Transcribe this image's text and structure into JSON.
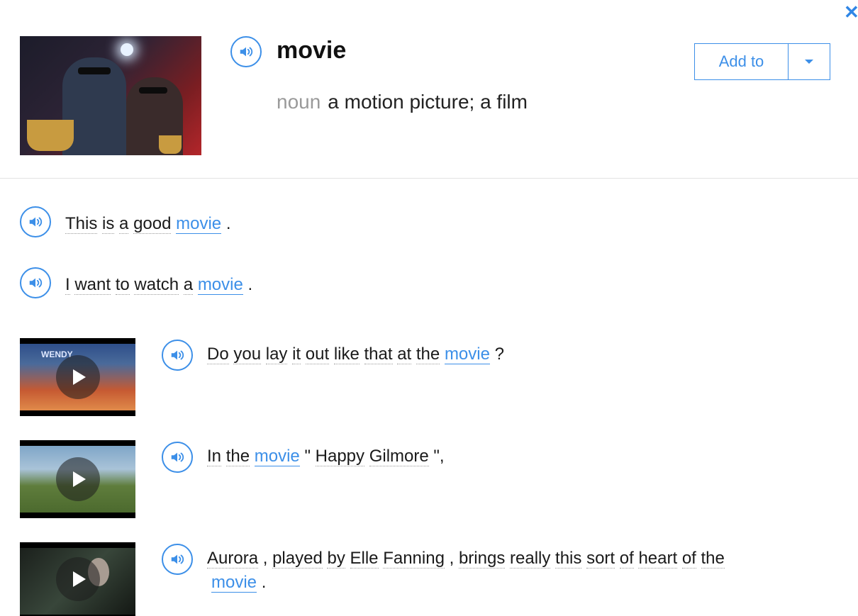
{
  "header": {
    "close_icon": "close-icon",
    "word": "movie",
    "part_of_speech": "noun",
    "definition": "a motion picture; a film",
    "add_to_label": "Add to",
    "add_to_caret_icon": "caret-down-icon"
  },
  "colors": {
    "accent": "#3c8fe8",
    "muted": "#9a9a9a",
    "text": "#1a1a1a"
  },
  "examples": [
    {
      "words": [
        "This",
        "is",
        "a",
        "good"
      ],
      "keyword": "movie",
      "tail": "."
    },
    {
      "words": [
        "I",
        "want",
        "to",
        "watch",
        "a"
      ],
      "keyword": "movie",
      "tail": "."
    }
  ],
  "videos": [
    {
      "thumb_text": "WENDY",
      "pre": [
        "Do",
        "you",
        "lay",
        "it",
        "out",
        "like",
        "that",
        "at",
        "the"
      ],
      "keyword": "movie",
      "tail": "?"
    },
    {
      "pre": [
        "In",
        "the"
      ],
      "keyword": "movie",
      "post_quote_open": "\"",
      "post": [
        "Happy",
        "Gilmore"
      ],
      "post_quote_close": "\","
    },
    {
      "line1": {
        "w1": "Aurora",
        "p1": ",",
        "w2": [
          "played",
          "by",
          "Elle",
          "Fanning"
        ],
        "p2": ",",
        "w3": [
          "brings",
          "really",
          "this",
          "sort",
          "of",
          "heart",
          "of",
          "the"
        ]
      },
      "keyword": "movie",
      "tail": "."
    }
  ]
}
